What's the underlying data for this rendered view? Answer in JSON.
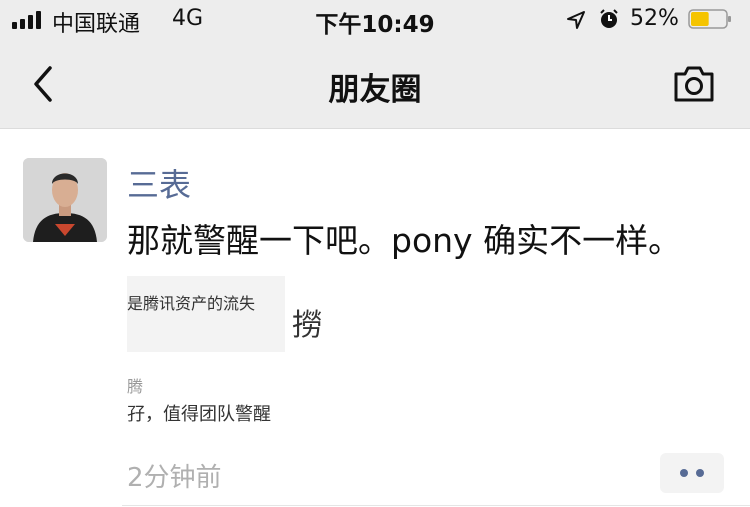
{
  "status_bar": {
    "carrier": "中国联通",
    "network": "4G",
    "time": "下午10:49",
    "battery_percent": "52%",
    "battery_level": 0.52,
    "battery_color": "#f5c400"
  },
  "nav": {
    "title": "朋友圈",
    "back_icon": "chevron-left-icon",
    "camera_icon": "camera-icon"
  },
  "post": {
    "author": "三表",
    "text": "那就警醒一下吧。pony 确实不一样。",
    "shared_card_text": "是腾讯资产的流失",
    "shared_side_text": "撈",
    "comment_line_1": "腾",
    "comment_line_2": "孖，值得团队警醒",
    "time": "2分钟前",
    "more_icon": "more-dots-icon",
    "link_color": "#576b95"
  }
}
